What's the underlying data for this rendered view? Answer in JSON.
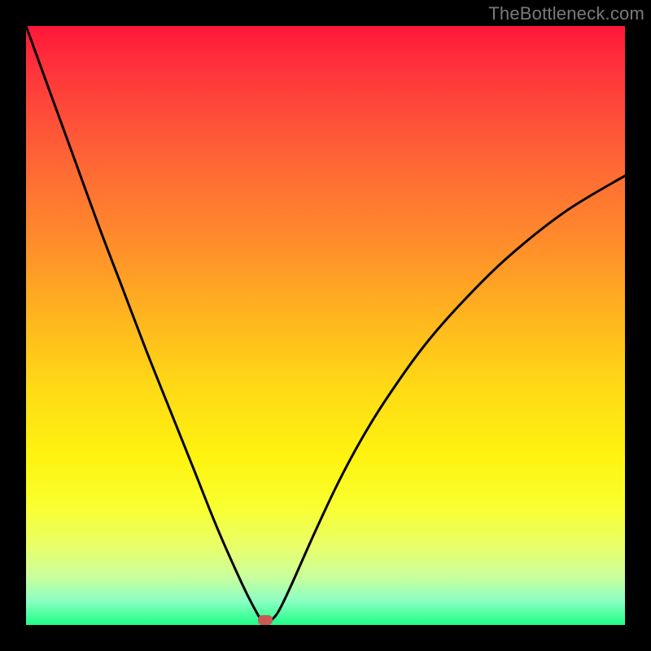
{
  "watermark": {
    "text": "TheBottleneck.com"
  },
  "colors": {
    "frame": "#000000",
    "curve": "#000000",
    "marker": "#c85a54",
    "gradient_top": "#ff173a",
    "gradient_bottom": "#1fff86",
    "watermark": "#7a7a7a"
  },
  "chart_data": {
    "type": "line",
    "title": "",
    "xlabel": "",
    "ylabel": "",
    "xlim": [
      0,
      100
    ],
    "ylim": [
      0,
      100
    ],
    "grid": false,
    "legend": false,
    "series": [
      {
        "name": "bottleneck-curve",
        "x": [
          0,
          4,
          8,
          12,
          16,
          20,
          24,
          28,
          32,
          36,
          38,
          39.5,
          40.5,
          42,
          44,
          48,
          52,
          56,
          60,
          66,
          72,
          80,
          90,
          100
        ],
        "y": [
          100,
          89,
          78,
          67,
          56.5,
          46,
          36,
          26,
          16,
          7,
          3,
          0.5,
          0.5,
          2,
          6,
          15,
          23.5,
          31,
          37.5,
          46,
          53,
          61,
          69,
          75
        ]
      }
    ],
    "markers": [
      {
        "name": "optimum",
        "x": 40,
        "y": 0.8
      }
    ],
    "annotations": []
  }
}
